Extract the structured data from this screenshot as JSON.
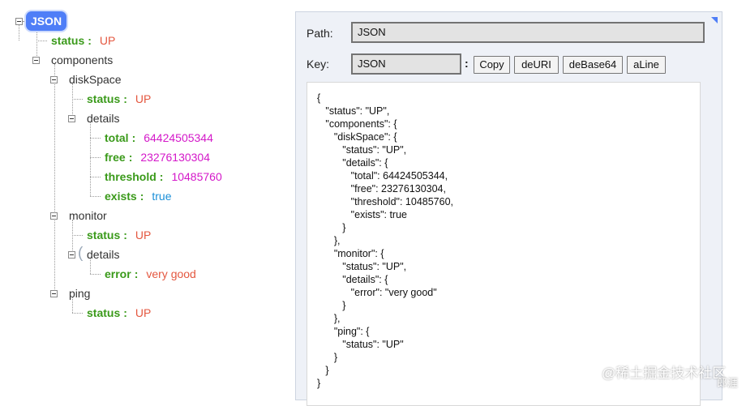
{
  "tree": {
    "root_label": "JSON",
    "status_key": "status",
    "status_val": "UP",
    "components_label": "components",
    "diskspace_label": "diskSpace",
    "disk_status_key": "status",
    "disk_status_val": "UP",
    "disk_details_label": "details",
    "total_key": "total",
    "total_val": "64424505344",
    "free_key": "free",
    "free_val": "23276130304",
    "threshold_key": "threshold",
    "threshold_val": "10485760",
    "exists_key": "exists",
    "exists_val": "true",
    "monitor_label": "monitor",
    "mon_status_key": "status",
    "mon_status_val": "UP",
    "mon_details_label": "details",
    "error_key": "error",
    "error_val": "very good",
    "ping_label": "ping",
    "ping_status_key": "status",
    "ping_status_val": "UP",
    "separator": ":"
  },
  "panel": {
    "path_label": "Path:",
    "path_value": "JSON",
    "key_label": "Key:",
    "key_value": "JSON",
    "colon": ":",
    "buttons": {
      "copy": "Copy",
      "deuri": "deURI",
      "debase64": "deBase64",
      "aline": "aLine"
    },
    "json_text": "{\n   \"status\": \"UP\",\n   \"components\": {\n      \"diskSpace\": {\n         \"status\": \"UP\",\n         \"details\": {\n            \"total\": 64424505344,\n            \"free\": 23276130304,\n            \"threshold\": 10485760,\n            \"exists\": true\n         }\n      },\n      \"monitor\": {\n         \"status\": \"UP\",\n         \"details\": {\n            \"error\": \"very good\"\n         }\n      },\n      \"ping\": {\n         \"status\": \"UP\"\n      }\n   }\n}"
  },
  "watermark": {
    "text": "@稀土掘金技术社区",
    "author": "郎涯"
  },
  "colors": {
    "key": "#3a9a1a",
    "string": "#e4573f",
    "number": "#d418c9",
    "boolean": "#1a8fd8",
    "root": "#4f7ef7"
  }
}
